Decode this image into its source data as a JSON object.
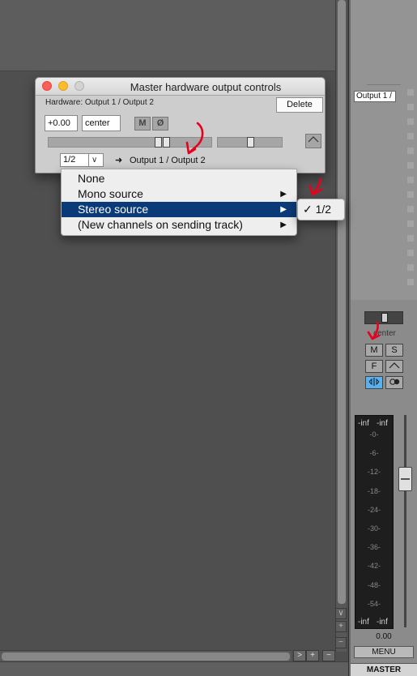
{
  "window": {
    "title": "Master hardware output controls",
    "hardware_label": "Hardware: Output 1 / Output 2",
    "delete_label": "Delete",
    "volume_value": "+0.00",
    "pan_value": "center",
    "mute_label": "M",
    "phase_label": "Ø",
    "env_icon": "envelope-icon",
    "channel_select_value": "1/2",
    "arrow_icon": "right-arrow-icon",
    "output_text": "Output 1 / Output 2",
    "pan_slider_fraction": 0.5,
    "width_slider_fraction": 0.5
  },
  "menu": {
    "items": [
      {
        "label": "None",
        "has_submenu": false
      },
      {
        "label": "Mono source",
        "has_submenu": true
      },
      {
        "label": "Stereo source",
        "has_submenu": true,
        "selected": true
      },
      {
        "label": "(New channels on sending track)",
        "has_submenu": true
      }
    ]
  },
  "submenu": {
    "check": "✓",
    "item": "1/2"
  },
  "mixer": {
    "output_label": "Output 1 /",
    "pan_label": "center",
    "mute": "M",
    "solo": "S",
    "fx": "F",
    "env_icon": "envelope-icon",
    "phase_icon": "phase-icon",
    "rec_icon": "record-arm-icon",
    "meter_top_left": "-inf",
    "meter_top_right": "-inf",
    "meter_scale": [
      "-0-",
      "-6-",
      "-12-",
      "-18-",
      "-24-",
      "-30-",
      "-36-",
      "-42-",
      "-48-",
      "-54-"
    ],
    "meter_bottom_left": "-inf",
    "meter_bottom_right": "-inf",
    "volume": "0.00",
    "menu_label": "MENU",
    "track_name": "MASTER"
  },
  "scroll": {
    "down": "∨",
    "plus": "+",
    "minus": "−",
    "right": ">",
    "h_plus": "+",
    "h_minus": "−"
  },
  "colors": {
    "selection": "#0b3a78",
    "close": "#fc5f57",
    "minimize": "#fdbb2e",
    "zoom_inactive": "#d3d3d3",
    "annotation": "#e8001c",
    "phase_active": "#5ab1ee"
  }
}
